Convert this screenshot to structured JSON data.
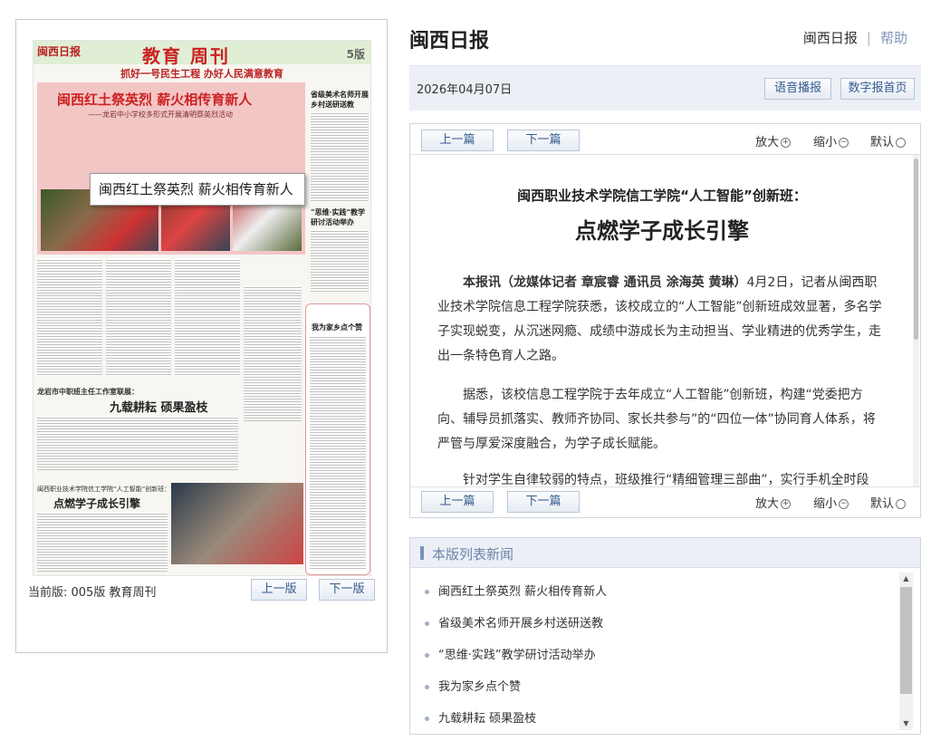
{
  "newspaper": {
    "logo": "闽西日报",
    "section_title": "教育  周刊",
    "edition": "5版",
    "slogan": "抓好一号民生工程  办好人民满意教育",
    "headline": "闽西红土祭英烈  薪火相传育新人",
    "headline_sub": "——龙岩中小学校多形式开展清明祭英烈活动",
    "side_head_1": "省级美术名师开展乡村送研送教",
    "side_head_2": "“思维·实践”教学研讨活动举办",
    "mid_kicker": "龙岩市中职班主任工作室联展：",
    "mid_head": "九载耕耘  硕果盈枝",
    "low_kicker": "闽西职业技术学院信工学院“人工智能”创新班：",
    "low_head": "点燃学子成长引擎",
    "column_head": "我为家乡点个赞",
    "tooltip": "闽西红土祭英烈 薪火相传育新人"
  },
  "left_footer": {
    "current_version": "当前版: 005版 教育周刊",
    "prev_page": "上一版",
    "next_page": "下一版"
  },
  "header": {
    "site_title": "闽西日报",
    "link_home": "闽西日报",
    "link_help": "帮助"
  },
  "datebar": {
    "date": "2026年04月07日",
    "voice_button": "语音播报",
    "digital_home_button": "数字报首页"
  },
  "article_toolbar": {
    "prev": "上一篇",
    "next": "下一篇",
    "zoom_in": "放大",
    "zoom_out": "缩小",
    "default": "默认"
  },
  "article": {
    "subtitle": "闽西职业技术学院信工学院“人工智能”创新班：",
    "title": "点燃学子成长引擎",
    "p1_lead": "本报讯（龙媒体记者 章宸睿 通讯员 涂海英 黄琳）",
    "p1_rest": "4月2日，记者从闽西职业技术学院信息工程学院获悉，该校成立的“人工智能”创新班成效显著，多名学子实现蜕变，从沉迷网瘾、成绩中游成长为主动担当、学业精进的优秀学生，走出一条特色育人之路。",
    "p2": "据悉，该校信息工程学院于去年成立“人工智能”创新班，构建“党委把方向、辅导员抓落实、教师齐协同、家长共参与”的“四位一体”协同育人体系，将严管与厚爱深度融合，为学子成长赋能。",
    "p3": "针对学生自律较弱的特点，班级推行“精细管理三部曲”，实行手机全时段"
  },
  "news_list": {
    "title": "本版列表新闻",
    "items": [
      "闽西红土祭英烈 薪火相传育新人",
      "省级美术名师开展乡村送研送教",
      "“思维·实践”教学研讨活动举办",
      "我为家乡点个赞",
      "九载耕耘 硕果盈枝"
    ]
  },
  "icons": {
    "zoom_in": "plus-circle-icon",
    "zoom_out": "minus-circle-icon",
    "default": "circle-icon"
  },
  "colors": {
    "accent_blue": "#345b8e",
    "list_title": "#6b84ad",
    "newspaper_red": "#cc2222"
  }
}
